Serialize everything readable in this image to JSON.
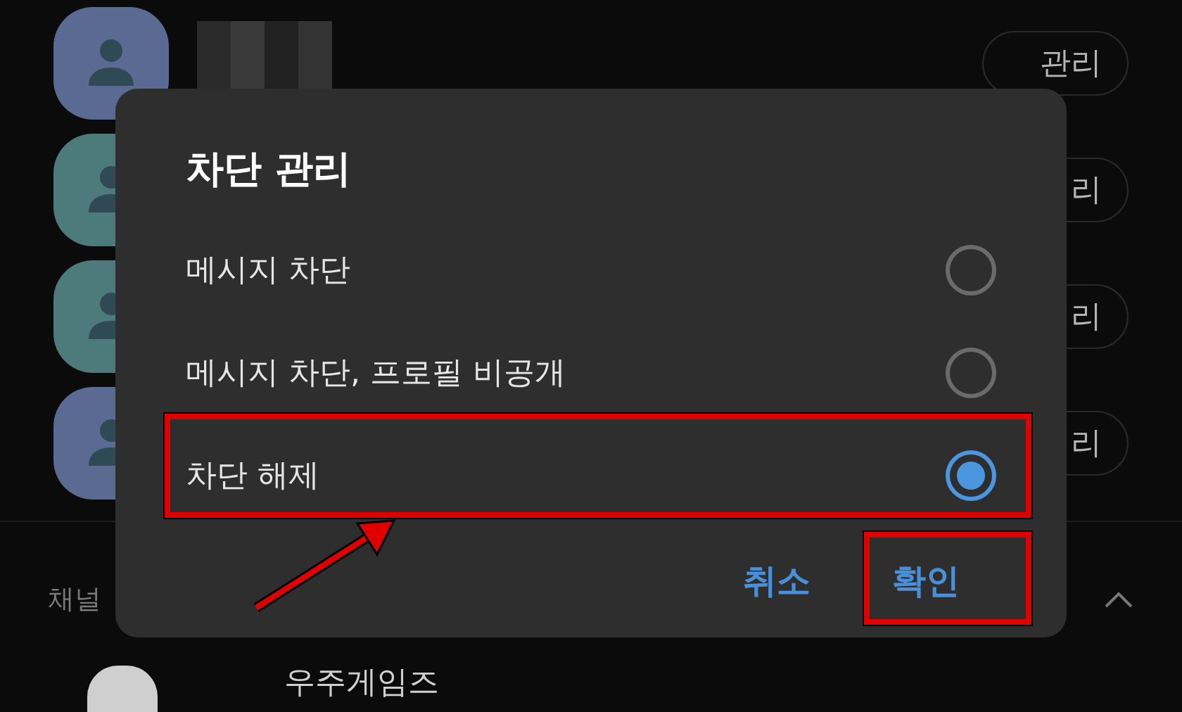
{
  "blocked_list": [
    {
      "color": "#5a6a93",
      "kind": "blurred",
      "button": "관리"
    },
    {
      "color": "#4d7b7b",
      "kind": "hidden",
      "button": "리"
    },
    {
      "color": "#4d7b7b",
      "kind": "hidden",
      "button": "리"
    },
    {
      "color": "#5a6a93",
      "kind": "hidden",
      "button": "리"
    }
  ],
  "channel_section": {
    "title": "채널",
    "expanded": true,
    "items": [
      {
        "name": "우주게임즈"
      }
    ]
  },
  "dialog": {
    "title": "차단 관리",
    "options": [
      {
        "label": "메시지 차단",
        "selected": false
      },
      {
        "label": "메시지 차단, 프로필 비공개",
        "selected": false
      },
      {
        "label": "차단 해제",
        "selected": true
      }
    ],
    "buttons": [
      "취소",
      "확인"
    ]
  }
}
